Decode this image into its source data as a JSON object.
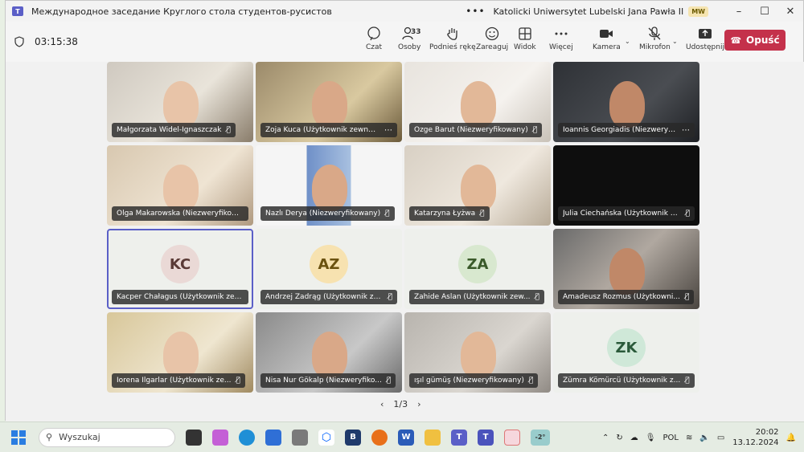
{
  "window": {
    "title": "Международное заседание Круглого стола студентов-русистов",
    "org": "Katolicki Uniwersytet Lubelski Jana Pawła II",
    "user_badge": "MW",
    "more": "•••"
  },
  "meeting": {
    "timer": "03:15:38",
    "participants_count": "33",
    "tools": {
      "chat": "Czat",
      "people": "Osoby",
      "raise_hand": "Podnieś rękę",
      "react": "Zareaguj",
      "view": "Widok",
      "more": "Więcej",
      "camera": "Kamera",
      "mic": "Mikrofon",
      "share": "Udostępnij"
    },
    "leave": "Opuść",
    "pager": "1/3"
  },
  "tiles": [
    {
      "name": "Małgorzata Widel-Ignaszczak",
      "type": "video",
      "muted": true
    },
    {
      "name": "Zoja Kuca (Użytkownik zewnęt...",
      "type": "video",
      "more": true
    },
    {
      "name": "Özge Barut (Niezweryfikowany)",
      "type": "video",
      "muted": true
    },
    {
      "name": "Ioannis Georgiadis (Niezweryfi...",
      "type": "video",
      "more": true
    },
    {
      "name": "Olga Makarowska (Niezweryfikowa...",
      "type": "video"
    },
    {
      "name": "Nazlı Derya (Niezweryfikowany)",
      "type": "video",
      "muted": true
    },
    {
      "name": "Katarzyna Łyżwa",
      "type": "video",
      "muted": true
    },
    {
      "name": "Julia Ciechańska (Użytkownik z...",
      "type": "dark",
      "muted": true
    },
    {
      "name": "Kacper Chałagus (Użytkownik zewn...",
      "type": "avatar",
      "initials": "KC",
      "selected": true
    },
    {
      "name": "Andrzej Zadrąg (Użytkownik ze...",
      "type": "avatar",
      "initials": "AZ",
      "muted": true
    },
    {
      "name": "Zahide Aslan (Użytkownik zew...",
      "type": "avatar",
      "initials": "ZA",
      "muted": true
    },
    {
      "name": "Amadeusz Rozmus (Użytkowni...",
      "type": "video",
      "muted": true
    },
    {
      "name": "Iorena Ilgarlar (Użytkownik ze...",
      "type": "video",
      "muted": true
    },
    {
      "name": "Nisa Nur Gökalp (Niezweryfiko...",
      "type": "video",
      "muted": true
    },
    {
      "name": "ışıl gümüş (Niezweryfikowany)",
      "type": "video",
      "muted": true
    },
    {
      "name": "Zümra Kömürcü (Użytkownik z...",
      "type": "avatar",
      "initials": "ZK",
      "muted": true
    }
  ],
  "taskbar": {
    "search_placeholder": "Wyszukaj",
    "weather": "-2°",
    "language": "POL",
    "time": "20:02",
    "date": "13.12.2024"
  }
}
